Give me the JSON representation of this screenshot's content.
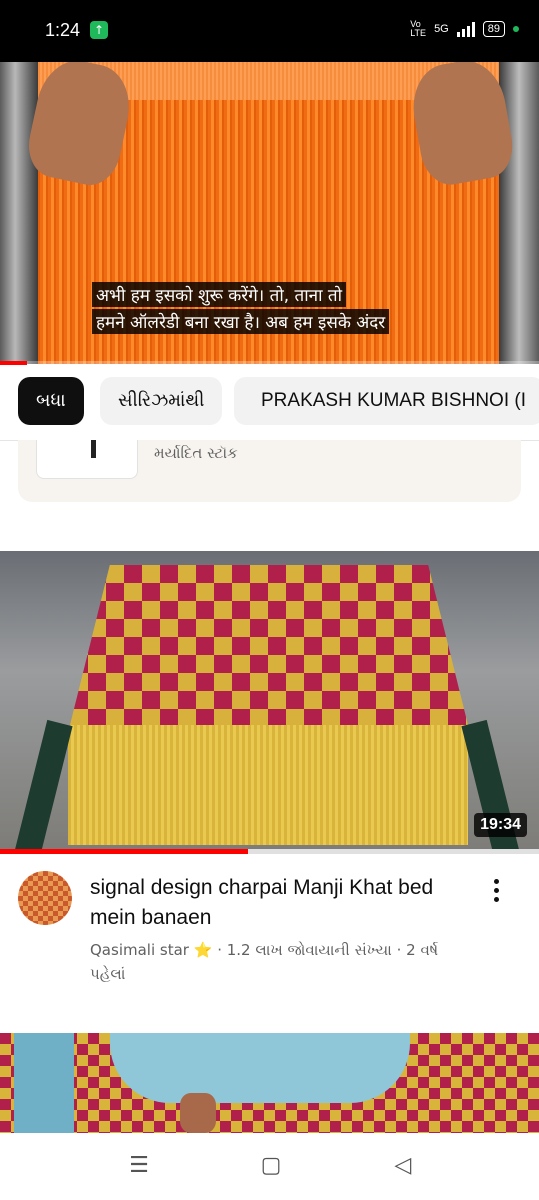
{
  "status_bar": {
    "time": "1:24",
    "network": "5G",
    "battery": "89"
  },
  "video": {
    "subtitle_line1": "अभी हम इसको शुरू करेंगे। तो, ताना तो",
    "subtitle_line2": "हमने ऑलरेडी बना रखा है। अब हम इसके अंदर",
    "progress_fraction": 0.05
  },
  "chips": [
    {
      "label": "બધા",
      "selected": true
    },
    {
      "label": "સીરિઝમાંથી",
      "selected": false
    },
    {
      "label": "PRAKASH KUMAR BISHNOI (I",
      "selected": false
    }
  ],
  "product": {
    "stock_label": "મર્યાદિત સ્ટૉક"
  },
  "feed_item": {
    "duration": "19:34",
    "watched_fraction": 0.46,
    "title": "signal design charpai Manji Khat bed mein banaen",
    "channel": "Qasimali star",
    "badge": "⭐",
    "meta": " · 1.2 લાખ જોવાયાની સંખ્યા · 2 વર્ષ પહેલાં"
  },
  "navbar": {
    "menu_icon": "☰",
    "home_icon": "▢",
    "back_icon": "◁"
  },
  "colors": {
    "accent_red": "#ff0000",
    "chip_active_bg": "#0f0f0f",
    "thread_orange": "#f06b12"
  }
}
